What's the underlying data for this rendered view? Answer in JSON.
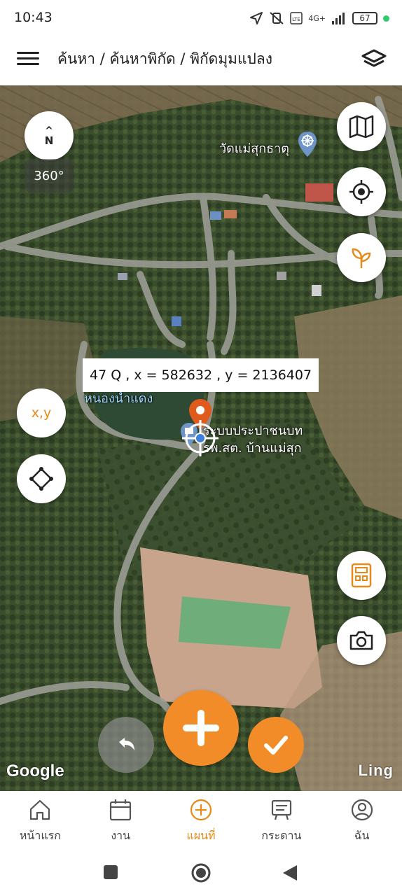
{
  "status_bar": {
    "time": "10:43",
    "network": "4G+",
    "battery": "67"
  },
  "header": {
    "breadcrumb": "ค้นหา / ค้นหาพิกัด / พิกัดมุมแปลง",
    "menu_icon": "hamburger-icon",
    "layers_icon": "layers-icon"
  },
  "map": {
    "compass_label": "N",
    "rotation_label": "360°",
    "coordinate_label": "47 Q , x = 582632 , y = 2136407",
    "xy_button_label": "x,y",
    "place_labels": {
      "temple": "วัดแม่สุกธาตุ",
      "pond": "หนองน้ำแดง",
      "water_system_line1": "ระบบประปาชนบท",
      "water_system_line2": "รพ.สต. บ้านแม่สุก"
    },
    "google_attribution": "Google",
    "brand_watermark": "Ling"
  },
  "bottom_nav": {
    "items": [
      {
        "label": "หน้าแรก",
        "icon": "home-icon"
      },
      {
        "label": "งาน",
        "icon": "calendar-icon"
      },
      {
        "label": "แผนที่",
        "icon": "plus-circle-icon",
        "active": true
      },
      {
        "label": "กระดาน",
        "icon": "board-icon"
      },
      {
        "label": "ฉัน",
        "icon": "user-icon"
      }
    ]
  },
  "colors": {
    "accent": "#f28c28",
    "marker": "#e05a1c"
  }
}
